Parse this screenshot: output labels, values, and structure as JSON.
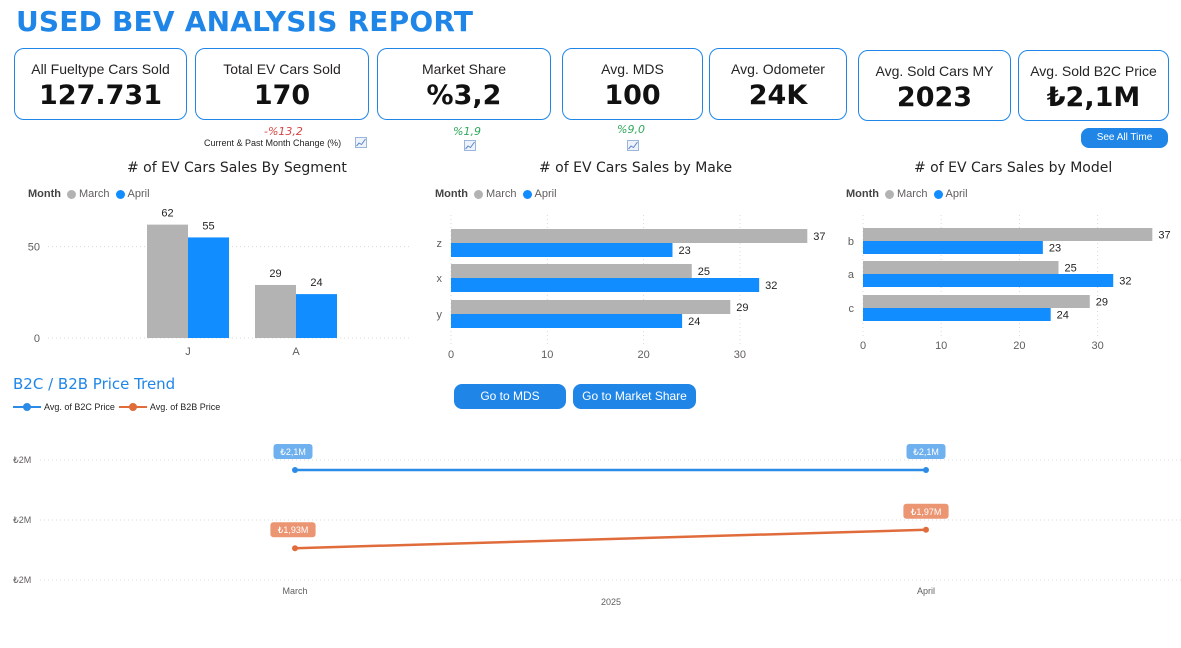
{
  "header": {
    "title": "USED BEV ANALYSIS REPORT"
  },
  "kpis": [
    {
      "label": "All Fueltype Cars Sold",
      "value": "127.731"
    },
    {
      "label": "Total EV Cars Sold",
      "value": "170"
    },
    {
      "label": "Market Share",
      "value": "%3,2"
    },
    {
      "label": "Avg. MDS",
      "value": "100"
    },
    {
      "label": "Avg. Odometer",
      "value": "24K"
    },
    {
      "label": "Avg. Sold Cars MY",
      "value": "2023"
    },
    {
      "label": "Avg. Sold B2C Price",
      "value": "₺2,1M"
    }
  ],
  "changes": {
    "ev_cars": "-%13,2",
    "market_share": "%1,9",
    "mds": "%9,0",
    "note": "Current & Past Month Change (%)"
  },
  "buttons": {
    "see_all_time": "See All Time",
    "go_mds": "Go to MDS",
    "go_market_share": "Go to Market Share"
  },
  "legend": {
    "field": "Month",
    "march": "March",
    "april": "April"
  },
  "colors": {
    "march": "#b3b3b3",
    "april": "#118dff",
    "b2c": "#2b8be6",
    "b2b": "#e06c3c",
    "accent": "#1f86e8"
  },
  "chart_data": [
    {
      "type": "bar",
      "title": "# of EV Cars Sales By Segment",
      "categories": [
        "J",
        "A"
      ],
      "series": [
        {
          "name": "March",
          "values": [
            62,
            29
          ]
        },
        {
          "name": "April",
          "values": [
            55,
            24
          ]
        }
      ],
      "ylim": [
        0,
        70
      ],
      "yticks": [
        0,
        50
      ],
      "legend": "top-left"
    },
    {
      "type": "bar",
      "orientation": "horizontal",
      "title": "# of EV Cars Sales by Make",
      "categories": [
        "z",
        "x",
        "y"
      ],
      "series": [
        {
          "name": "March",
          "values": [
            37,
            25,
            29
          ]
        },
        {
          "name": "April",
          "values": [
            23,
            32,
            24
          ]
        }
      ],
      "xlim": [
        0,
        40
      ],
      "xticks": [
        0,
        10,
        20,
        30
      ],
      "legend": "top-left"
    },
    {
      "type": "bar",
      "orientation": "horizontal",
      "title": "# of EV Cars Sales by Model",
      "categories": [
        "b",
        "a",
        "c"
      ],
      "series": [
        {
          "name": "March",
          "values": [
            37,
            25,
            29
          ]
        },
        {
          "name": "April",
          "values": [
            23,
            32,
            24
          ]
        }
      ],
      "xlim": [
        0,
        38
      ],
      "xticks": [
        0,
        10,
        20,
        30
      ],
      "legend": "top-left"
    },
    {
      "type": "line",
      "title": "B2C / B2B Price Trend",
      "x": [
        "March",
        "April"
      ],
      "xlabel": "2025",
      "series": [
        {
          "name": "Avg. of B2C Price",
          "values": [
            2.1,
            2.1
          ],
          "labels": [
            "₺2,1M",
            "₺2,1M"
          ]
        },
        {
          "name": "Avg. of B2B Price",
          "values": [
            1.93,
            1.97
          ],
          "labels": [
            "₺1,93M",
            "₺1,97M"
          ]
        }
      ],
      "yticks": [
        "₺2M",
        "₺2M",
        "₺2M"
      ],
      "legend": "top-left"
    }
  ]
}
